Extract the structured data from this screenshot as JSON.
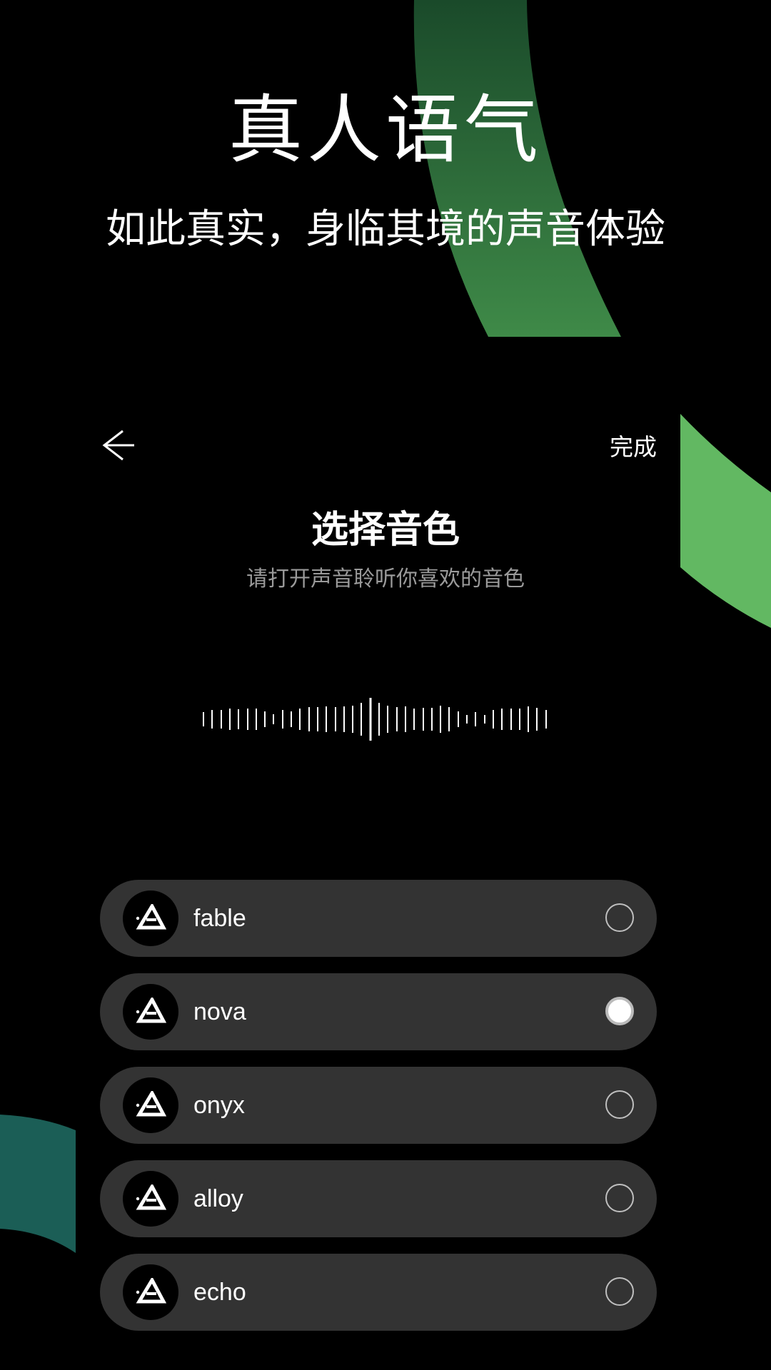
{
  "promo": {
    "title": "真人语气",
    "subtitle": "如此真实，身临其境的声音体验"
  },
  "header": {
    "back_icon": "arrow-left-icon",
    "done_label": "完成"
  },
  "sheet": {
    "title": "选择音色",
    "subtitle": "请打开声音聆听你喜欢的音色"
  },
  "voices": [
    {
      "name": "fable",
      "selected": false
    },
    {
      "name": "nova",
      "selected": true
    },
    {
      "name": "onyx",
      "selected": false
    },
    {
      "name": "alloy",
      "selected": false
    },
    {
      "name": "echo",
      "selected": false
    }
  ],
  "colors": {
    "background": "#000000",
    "accent_green": "#5fb85f",
    "accent_dark_green": "#2e6b3a",
    "accent_teal": "#1b5e56",
    "item_background": "#333333"
  }
}
